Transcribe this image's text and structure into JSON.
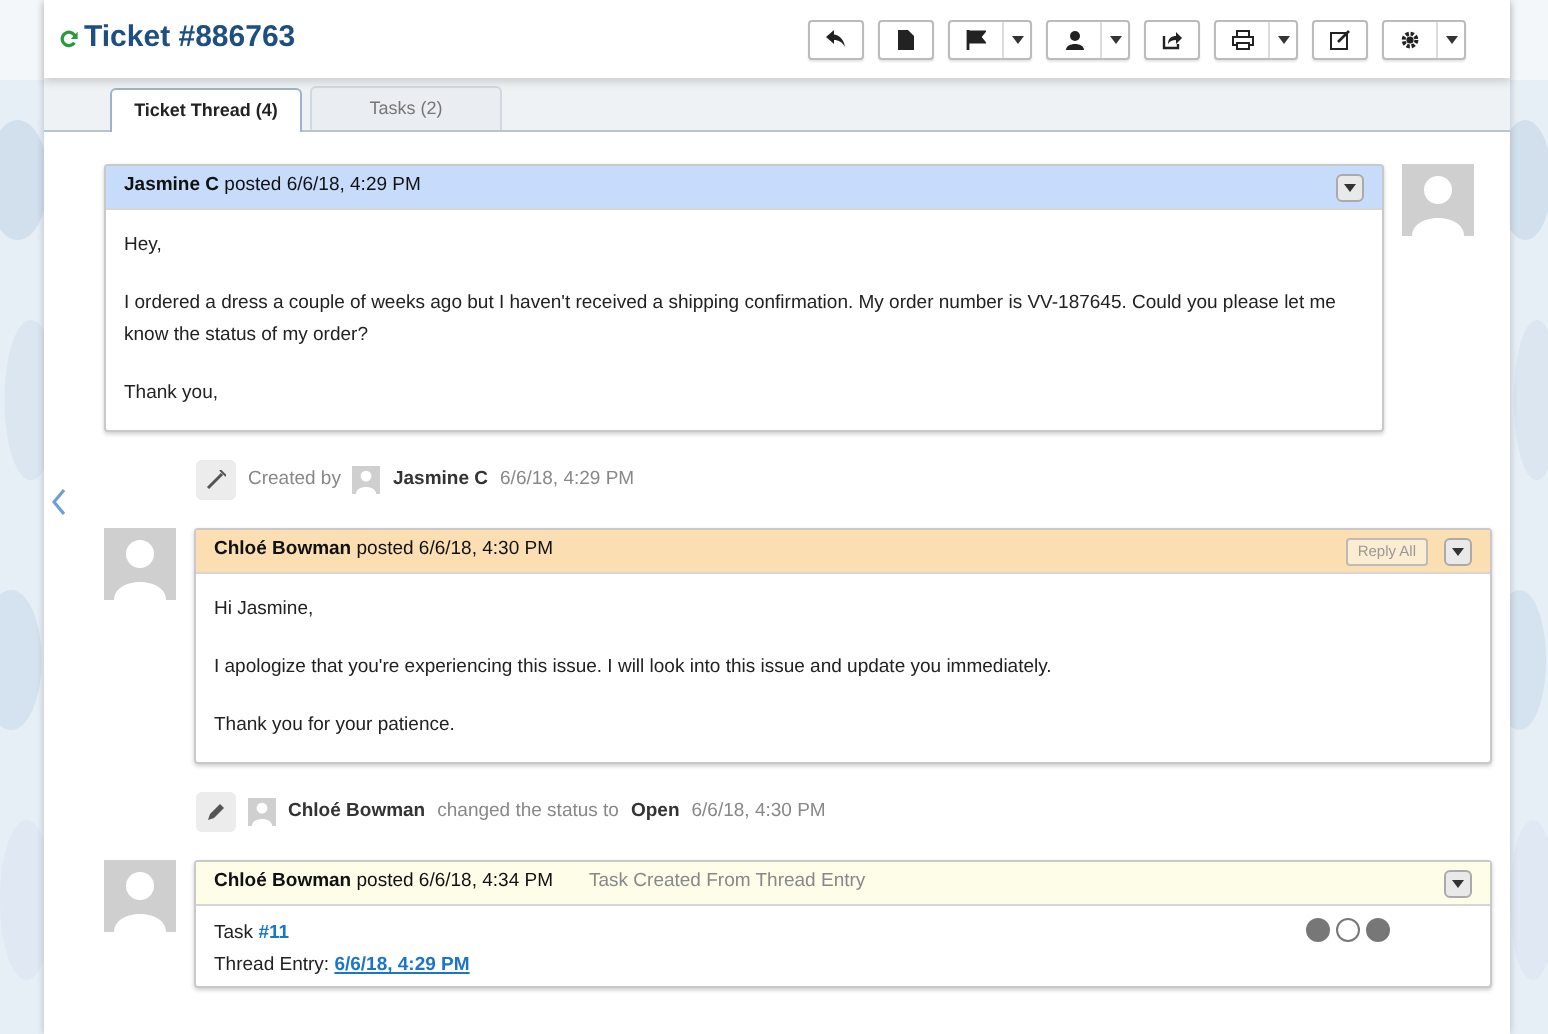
{
  "ticket": {
    "title": "Ticket #886763"
  },
  "toolbar": [
    {
      "kind": "single"
    },
    {
      "kind": "single"
    },
    {
      "kind": "dropdown"
    },
    {
      "kind": "dropdown"
    },
    {
      "kind": "single"
    },
    {
      "kind": "dropdown"
    },
    {
      "kind": "single"
    },
    {
      "kind": "dropdown"
    }
  ],
  "tabs": [
    {
      "label": "Ticket Thread (4)",
      "selected": true
    },
    {
      "label": "Tasks (2)",
      "selected": false
    }
  ],
  "thread": [
    {
      "kind": "customer_message",
      "color": "#c7dcfb",
      "author": "Jasmine C",
      "posted": "posted 6/6/18, 4:29 PM",
      "body": [
        [
          {
            "kind": "text",
            "text": "Hey,"
          }
        ],
        [
          {
            "kind": "text",
            "text": "I ordered a dress a couple of weeks ago but I haven't received a shipping confirmation. My order number is VV-187645. Could you please let me know the status of my order?"
          }
        ],
        [
          {
            "kind": "text",
            "text": "Thank you,"
          }
        ]
      ]
    },
    {
      "kind": "created_event",
      "parts": [
        {
          "kind": "text",
          "text": "Created by"
        },
        {
          "kind": "avatar"
        },
        {
          "kind": "user",
          "text": "Jasmine C"
        },
        {
          "kind": "text",
          "text": "6/6/18, 4:29 PM"
        }
      ]
    },
    {
      "kind": "agent_message",
      "color": "#fbdfb3",
      "author": "Chloé Bowman",
      "posted": "posted 6/6/18, 4:30 PM",
      "reply_all": "Reply All",
      "body": [
        [
          {
            "kind": "text",
            "text": "Hi Jasmine,"
          }
        ],
        [
          {
            "kind": "text",
            "text": "I apologize that you're experiencing this issue. I will look into this issue and update you immediately."
          }
        ],
        [
          {
            "kind": "text",
            "text": "Thank you for your patience."
          }
        ]
      ]
    },
    {
      "kind": "status_event",
      "parts": [
        {
          "kind": "avatar"
        },
        {
          "kind": "user",
          "text": "Chloé Bowman"
        },
        {
          "kind": "text",
          "text": "changed the status to"
        },
        {
          "kind": "user",
          "text": "Open"
        },
        {
          "kind": "text",
          "text": "6/6/18, 4:30 PM"
        }
      ]
    },
    {
      "kind": "task_message",
      "color": "#fdfde8",
      "author": "Chloé Bowman",
      "posted": "posted 6/6/18, 4:34 PM",
      "subtitle": "Task Created From Thread Entry",
      "dots": [
        {
          "selected": false
        },
        {
          "selected": true
        },
        {
          "selected": false
        }
      ],
      "body": [
        [
          {
            "kind": "text",
            "text": "Task"
          },
          {
            "kind": "link",
            "text": "#11"
          }
        ],
        [
          {
            "kind": "text",
            "text": "Thread Entry:"
          },
          {
            "kind": "underlined_link",
            "text": "6/6/18, 4:29 PM"
          }
        ]
      ]
    }
  ]
}
